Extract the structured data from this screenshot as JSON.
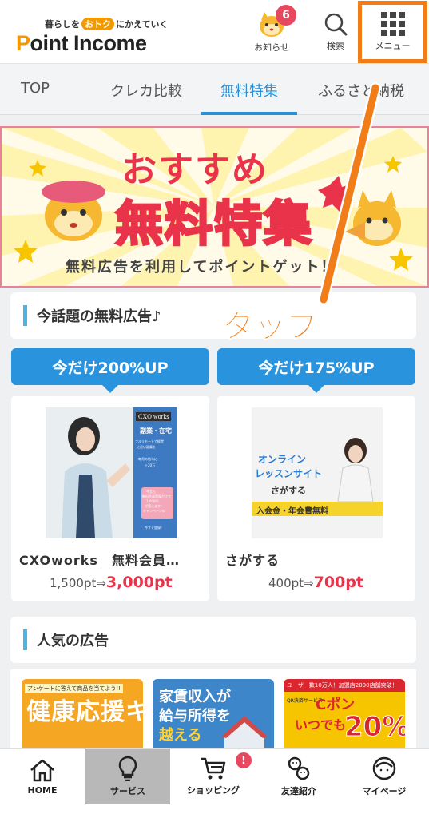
{
  "header": {
    "tagline_pre": "暮らしを",
    "tagline_badge": "おトク",
    "tagline_post": "にかえていく",
    "logo_p": "P",
    "logo_rest": "oint Income",
    "notice_label": "お知らせ",
    "notice_count": "6",
    "search_label": "検索",
    "menu_label": "メニュー"
  },
  "tabs": [
    {
      "label": "TOP"
    },
    {
      "label": "クレカ比較"
    },
    {
      "label": "無料特集"
    },
    {
      "label": "ふるさと納税"
    }
  ],
  "banner": {
    "title_line1": "おすすめ",
    "title_line2": "無料特集",
    "subtitle": "無料広告を利用してポイントゲット！"
  },
  "annotation": {
    "tap": "タップ",
    "highlight_color": "#f07d18"
  },
  "section_free": {
    "title": "今話題の無料広告♪"
  },
  "offers": [
    {
      "promo": "今だけ200%UP",
      "name": "CXOworks　無料会員…",
      "old_pt": "1,500pt⇒",
      "new_pt": "3,000pt",
      "thumb_title": "CXO works",
      "thumb_sub": "副業・在宅",
      "thumb_text1": "フルリモートで経営",
      "thumb_text2": "に近い副業を",
      "thumb_text3": "毎月の給与に",
      "thumb_text4": "＋20万",
      "thumb_text5": "今なら",
      "thumb_text6": "無料会員登録だけで",
      "thumb_text7": "1,000円",
      "thumb_text8": "が貰えます！",
      "thumb_text9": "キャンペーンの",
      "thumb_text10": "今すぐ登録！"
    },
    {
      "promo": "今だけ175%UP",
      "name": "さがする",
      "old_pt": "400pt⇒",
      "new_pt": "700pt",
      "thumb_line1": "オンライン",
      "thumb_line2": "レッスンサイト",
      "thumb_brand": "さがする",
      "thumb_strip": "入会金・年会費無料"
    }
  ],
  "section_popular": {
    "title": "人気の広告",
    "items": [
      {
        "top": "アンケートに答えて商品を当てよう!!",
        "main": "健康応援キャンペーン"
      },
      {
        "main1": "家賃収入が",
        "main2": "給与所得を",
        "main3": "越える"
      },
      {
        "top": "ユーザー数10万人！加盟店2000店舗突破！",
        "tag": "QR決済サービス",
        "brand": "Cポン",
        "sub": "いつでも",
        "pct": "20%"
      }
    ]
  },
  "bottom_nav": [
    {
      "label": "HOME",
      "icon": "home-icon"
    },
    {
      "label": "サービス",
      "icon": "lightbulb-icon"
    },
    {
      "label": "ショッピング",
      "icon": "cart-icon",
      "badge": "!"
    },
    {
      "label": "友達紹介",
      "icon": "friends-icon"
    },
    {
      "label": "マイページ",
      "icon": "mypage-icon"
    }
  ],
  "colors": {
    "brand_orange": "#f39800",
    "accent_blue": "#2a8fd6",
    "accent_red": "#e8334a"
  }
}
